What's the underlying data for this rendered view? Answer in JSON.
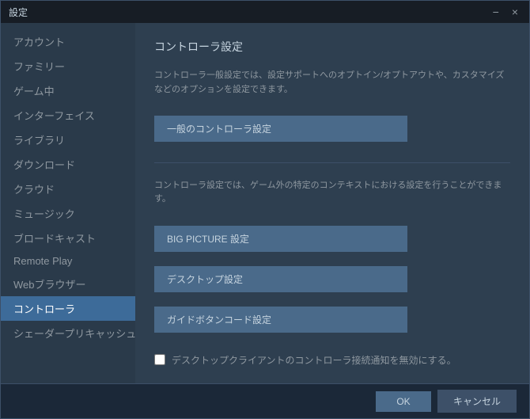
{
  "window": {
    "title": "設定",
    "close_btn": "×",
    "minimize_btn": "−"
  },
  "sidebar": {
    "items": [
      {
        "id": "account",
        "label": "アカウント",
        "active": false
      },
      {
        "id": "family",
        "label": "ファミリー",
        "active": false
      },
      {
        "id": "in-game",
        "label": "ゲーム中",
        "active": false
      },
      {
        "id": "interface",
        "label": "インターフェイス",
        "active": false
      },
      {
        "id": "library",
        "label": "ライブラリ",
        "active": false
      },
      {
        "id": "download",
        "label": "ダウンロード",
        "active": false
      },
      {
        "id": "cloud",
        "label": "クラウド",
        "active": false
      },
      {
        "id": "music",
        "label": "ミュージック",
        "active": false
      },
      {
        "id": "broadcast",
        "label": "ブロードキャスト",
        "active": false
      },
      {
        "id": "remote-play",
        "label": "Remote Play",
        "active": false
      },
      {
        "id": "web-browser",
        "label": "Webブラウザー",
        "active": false
      },
      {
        "id": "controller",
        "label": "コントローラ",
        "active": true
      },
      {
        "id": "shader-cache",
        "label": "シェーダープリキャッシュ",
        "active": false
      }
    ]
  },
  "main": {
    "section_title": "コントローラ設定",
    "section_desc": "コントローラ一般設定では、設定サポートへのオプトイン/オプトアウトや、カスタマイズなどのオプションを設定できます。",
    "general_btn": "一般のコントローラ設定",
    "section_desc2": "コントローラ設定では、ゲーム外の特定のコンテキストにおける設定を行うことができます。",
    "big_picture_btn": "BIG PICTURE 設定",
    "desktop_btn": "デスクトップ設定",
    "guide_btn": "ガイドボタンコード設定",
    "checkbox_label": "デスクトップクライアントのコントローラ接続通知を無効にする。",
    "checkbox_checked": false
  },
  "footer": {
    "ok_label": "OK",
    "cancel_label": "キャンセル"
  }
}
